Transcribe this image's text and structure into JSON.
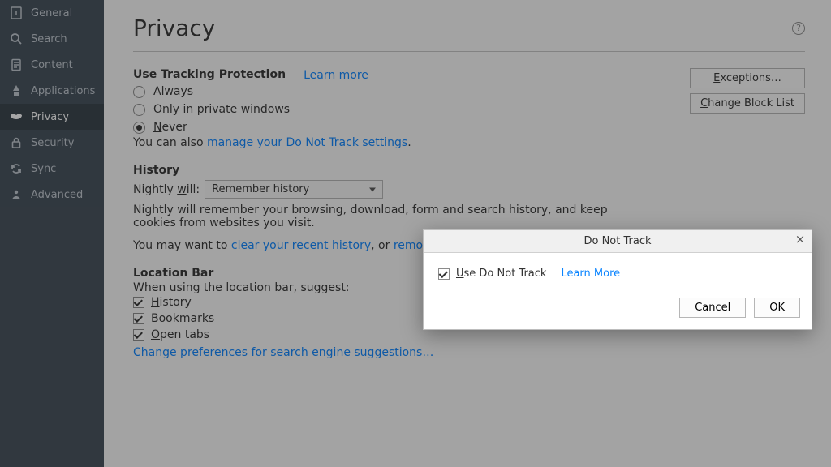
{
  "sidebar": {
    "items": [
      {
        "label": "General"
      },
      {
        "label": "Search"
      },
      {
        "label": "Content"
      },
      {
        "label": "Applications"
      },
      {
        "label": "Privacy"
      },
      {
        "label": "Security"
      },
      {
        "label": "Sync"
      },
      {
        "label": "Advanced"
      }
    ],
    "active_index": 4
  },
  "page": {
    "title": "Privacy"
  },
  "tracking": {
    "heading": "Use Tracking Protection",
    "learn_more": "Learn more",
    "options": {
      "always": "Always",
      "private": "Only in private windows",
      "never": "Never"
    },
    "selected": "never",
    "note_prefix": "You can also ",
    "note_link": "manage your Do Not Track settings",
    "exceptions_btn": "Exceptions…",
    "change_list_btn": "Change Block List"
  },
  "history": {
    "heading": "History",
    "will_label": "Nightly will:",
    "select_value": "Remember history",
    "desc": "Nightly will remember your browsing, download, form and search history, and keep cookies from websites you visit.",
    "note_prefix": "You may want to ",
    "clear_link": "clear your recent history",
    "or_text": ", or ",
    "remove_link": "remove individual cookies"
  },
  "location_bar": {
    "heading": "Location Bar",
    "intro": "When using the location bar, suggest:",
    "options": {
      "history": "History",
      "bookmarks": "Bookmarks",
      "open_tabs": "Open tabs"
    },
    "checked": {
      "history": true,
      "bookmarks": true,
      "open_tabs": true
    },
    "change_link": "Change preferences for search engine suggestions…"
  },
  "dialog": {
    "title": "Do Not Track",
    "checkbox_label": "Use Do Not Track",
    "checked": true,
    "learn_more": "Learn More",
    "cancel": "Cancel",
    "ok": "OK"
  }
}
